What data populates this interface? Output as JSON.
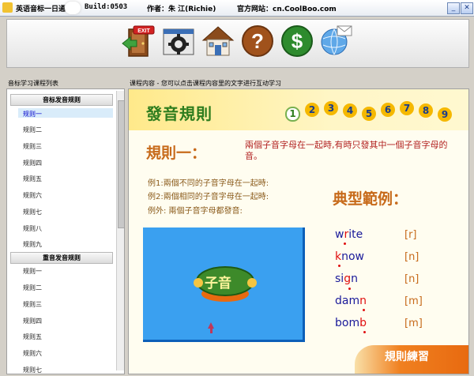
{
  "titlebar": {
    "app_name": "英语音标一日通",
    "build": "Build:0503",
    "author": "作者：朱 江(Richie)",
    "website": "官方网站：cn.CoolBoo.com",
    "minimize": "_",
    "close": "✕"
  },
  "toolbar": {
    "icons": [
      "exit-icon",
      "settings-icon",
      "home-icon",
      "help-icon",
      "dollar-icon",
      "globe-mail-icon"
    ]
  },
  "left_panel": {
    "caption": "音标学习课程列表",
    "group1_title": "音标发音规则",
    "group1_items": [
      "规则一",
      "规则二",
      "规则三",
      "规则四",
      "规则五",
      "规则六",
      "规则七",
      "规则八",
      "规则九"
    ],
    "group2_title": "重音发音规则",
    "group2_items": [
      "规则一",
      "规则二",
      "规则三",
      "规则四",
      "规则五",
      "规则六",
      "规则七"
    ]
  },
  "content_panel": {
    "caption": "课程内容 - 您可以点击课程内容里的文字进行互动学习",
    "title": "發音規則",
    "numbers": [
      "1",
      "2",
      "3",
      "4",
      "5",
      "6",
      "7",
      "8",
      "9"
    ],
    "rule_title": "規則一：",
    "rule_desc": "兩個子音字母在一起時,有時只發其中一個子音字母的音。",
    "examples": [
      "例1:兩個不同的子音字母在一起時:",
      "例2:兩個相同的子音字母在一起時:",
      "例外: 兩個子音字母都發音:"
    ],
    "typical_title": "典型範例：",
    "words": [
      {
        "pre": "w",
        "red": "r",
        "post": "ite",
        "phon": "[r]"
      },
      {
        "pre": "",
        "red": "k",
        "post": "now",
        "phon": "[n]"
      },
      {
        "pre": "si",
        "red": "g",
        "post": "n",
        "phon": "[n]"
      },
      {
        "pre": "dam",
        "red": "n",
        "post": "",
        "phon": "[m]"
      },
      {
        "pre": "bom",
        "red": "b",
        "post": "",
        "phon": "[m]"
      }
    ],
    "video_label": "子音",
    "practice_label": "規則練習"
  },
  "colors": {
    "title_green": "#2e7d1e",
    "rule_orange": "#c76a1a",
    "word_blue": "#1a1a9a",
    "video_blue": "#3aa0f0"
  }
}
